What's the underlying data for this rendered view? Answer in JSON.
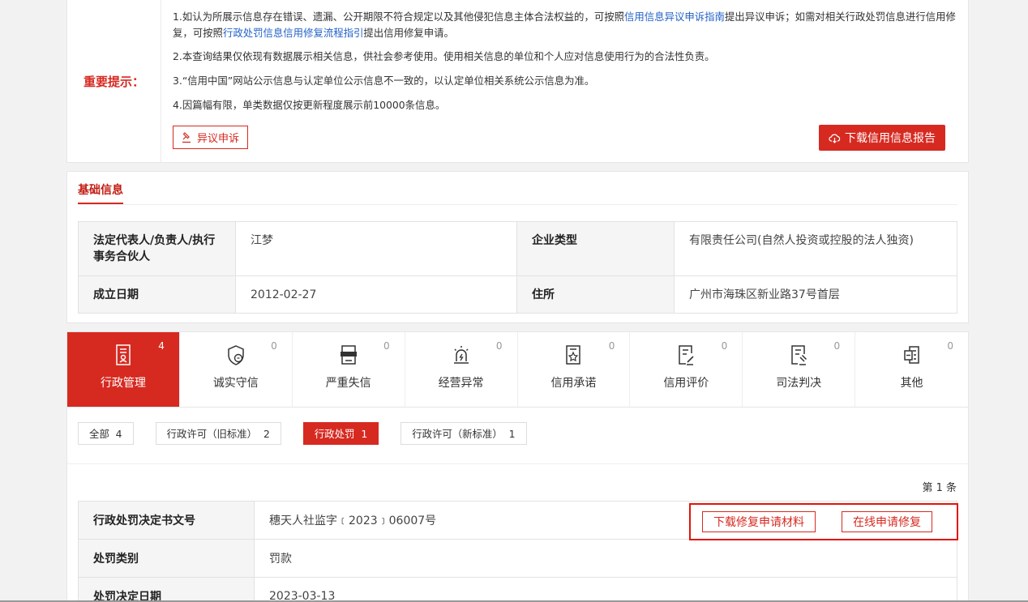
{
  "notice": {
    "label": "重要提示：",
    "line1_a": "1.如认为所展示信息存在错误、遗漏、公开期限不符合规定以及其他侵犯信息主体合法权益的，可按照",
    "line1_link1": "信用信息异议申诉指南",
    "line1_b": "提出异议申诉；如需对相关行政处罚信息进行信用修复，可按照",
    "line1_link2": "行政处罚信息信用修复流程指引",
    "line1_c": "提出信用修复申请。",
    "line2": "2.本查询结果仅依现有数据展示相关信息，供社会参考使用。使用相关信息的单位和个人应对信息使用行为的合法性负责。",
    "line3": "3.“信用中国”网站公示信息与认定单位公示信息不一致的，以认定单位相关系统公示信息为准。",
    "line4": "4.因篇幅有限，单类数据仅按更新程度展示前10000条信息。",
    "objection_button": "异议申诉",
    "download_report_button": "下载信用信息报告"
  },
  "basic": {
    "title": "基础信息",
    "rows": [
      {
        "k1": "法定代表人/负责人/执行事务合伙人",
        "v1": "江梦",
        "k2": "企业类型",
        "v2": "有限责任公司(自然人投资或控股的法人独资)"
      },
      {
        "k1": "成立日期",
        "v1": "2012-02-27",
        "k2": "住所",
        "v2": "广州市海珠区新业路37号首层"
      }
    ]
  },
  "categories": [
    {
      "label": "行政管理",
      "count": "4",
      "icon": "document-person-icon"
    },
    {
      "label": "诚实守信",
      "count": "0",
      "icon": "shield-credit-icon"
    },
    {
      "label": "严重失信",
      "count": "0",
      "icon": "dishonest-person-icon"
    },
    {
      "label": "经营异常",
      "count": "0",
      "icon": "alarm-icon"
    },
    {
      "label": "信用承诺",
      "count": "0",
      "icon": "pledge-star-icon"
    },
    {
      "label": "信用评价",
      "count": "0",
      "icon": "evaluation-icon"
    },
    {
      "label": "司法判决",
      "count": "0",
      "icon": "judgment-icon"
    },
    {
      "label": "其他",
      "count": "0",
      "icon": "other-docs-icon"
    }
  ],
  "sub_tabs": [
    {
      "label": "全部",
      "count": "4"
    },
    {
      "label": "行政许可（旧标准）",
      "count": "2"
    },
    {
      "label": "行政处罚",
      "count": "1"
    },
    {
      "label": "行政许可（新标准）",
      "count": "1"
    }
  ],
  "record_index": "第 1 条",
  "detail": [
    {
      "k": "行政处罚决定书文号",
      "v": "穗天人社监字﹝2023﹞06007号"
    },
    {
      "k": "处罚类别",
      "v": "罚款"
    },
    {
      "k": "处罚决定日期",
      "v": "2023-03-13"
    }
  ],
  "actions": {
    "download_material": "下载修复申请材料",
    "online_repair": "在线申请修复"
  },
  "colors": {
    "accent": "#d62a21",
    "link": "#2262c7"
  }
}
